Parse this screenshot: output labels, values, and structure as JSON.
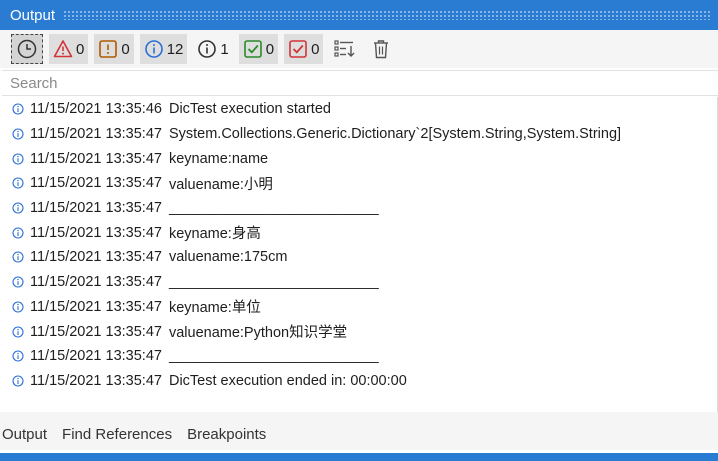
{
  "panel": {
    "title": "Output"
  },
  "toolbar": {
    "errors_count": "0",
    "warnings_count": "0",
    "info_count": "12",
    "trace_count": "1",
    "success_count": "0",
    "failed_count": "0"
  },
  "search": {
    "placeholder": "Search"
  },
  "log": [
    {
      "ts": "11/15/2021 13:35:46",
      "msg": "DicTest execution started"
    },
    {
      "ts": "11/15/2021 13:35:47",
      "msg": "System.Collections.Generic.Dictionary`2[System.String,System.String]"
    },
    {
      "ts": "11/15/2021 13:35:47",
      "msg": "keyname:name"
    },
    {
      "ts": "11/15/2021 13:35:47",
      "msg": "valuename:小明"
    },
    {
      "ts": "11/15/2021 13:35:47",
      "msg": "__________________________"
    },
    {
      "ts": "11/15/2021 13:35:47",
      "msg": "keyname:身高"
    },
    {
      "ts": "11/15/2021 13:35:47",
      "msg": "valuename:175cm"
    },
    {
      "ts": "11/15/2021 13:35:47",
      "msg": "__________________________"
    },
    {
      "ts": "11/15/2021 13:35:47",
      "msg": "keyname:单位"
    },
    {
      "ts": "11/15/2021 13:35:47",
      "msg": "valuename:Python知识学堂"
    },
    {
      "ts": "11/15/2021 13:35:47",
      "msg": "__________________________"
    },
    {
      "ts": "11/15/2021 13:35:47",
      "msg": "DicTest execution ended in: 00:00:00"
    }
  ],
  "tabs": {
    "output": "Output",
    "find_references": "Find References",
    "breakpoints": "Breakpoints"
  },
  "colors": {
    "accent": "#2a7cd3",
    "error": "#d13438",
    "warning": "#b05a00",
    "info": "#2a6fd6",
    "success": "#2a8a2a"
  }
}
